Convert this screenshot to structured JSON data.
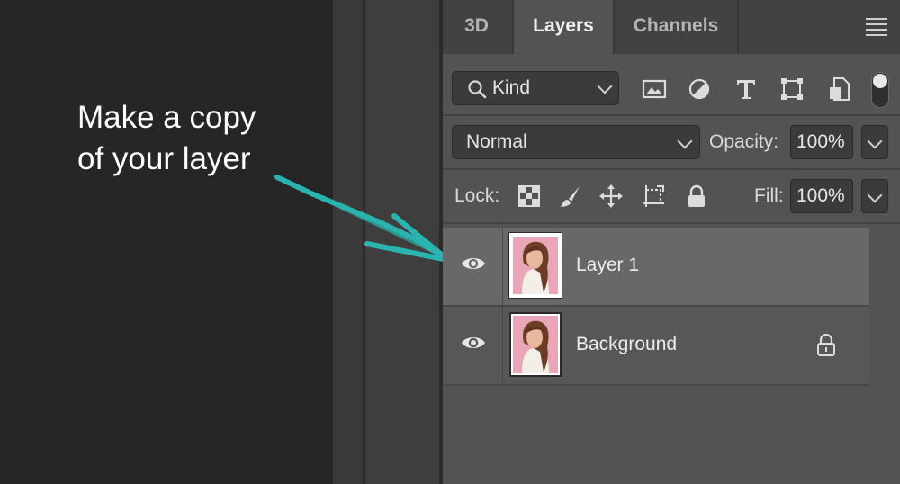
{
  "annotation": {
    "line1": "Make a copy",
    "line2": "of your layer",
    "arrow_color": "#2bb3b0"
  },
  "tabs": [
    {
      "label": "3D",
      "active": false
    },
    {
      "label": "Layers",
      "active": true
    },
    {
      "label": "Channels",
      "active": false
    }
  ],
  "panel_menu_icon": "hamburger-menu-icon",
  "filter": {
    "kind_label": "Kind",
    "icons": [
      "image-filter-icon",
      "adjustment-filter-icon",
      "type-filter-icon",
      "shape-filter-icon",
      "smart-object-filter-icon"
    ]
  },
  "blend": {
    "mode": "Normal",
    "opacity_label": "Opacity:",
    "opacity_value": "100%"
  },
  "lock": {
    "label": "Lock:",
    "icons": [
      "lock-transparent-pixels-icon",
      "lock-image-pixels-icon",
      "lock-position-icon",
      "lock-artboard-icon",
      "lock-all-icon"
    ],
    "fill_label": "Fill:",
    "fill_value": "100%"
  },
  "layers": [
    {
      "name": "Layer 1",
      "selected": true,
      "locked": false,
      "visible": true
    },
    {
      "name": "Background",
      "selected": false,
      "locked": true,
      "visible": true
    }
  ],
  "colors": {
    "panel_bg": "#535353",
    "tabbar_bg": "#424242",
    "selected_row": "#686868",
    "text": "#ececec"
  }
}
